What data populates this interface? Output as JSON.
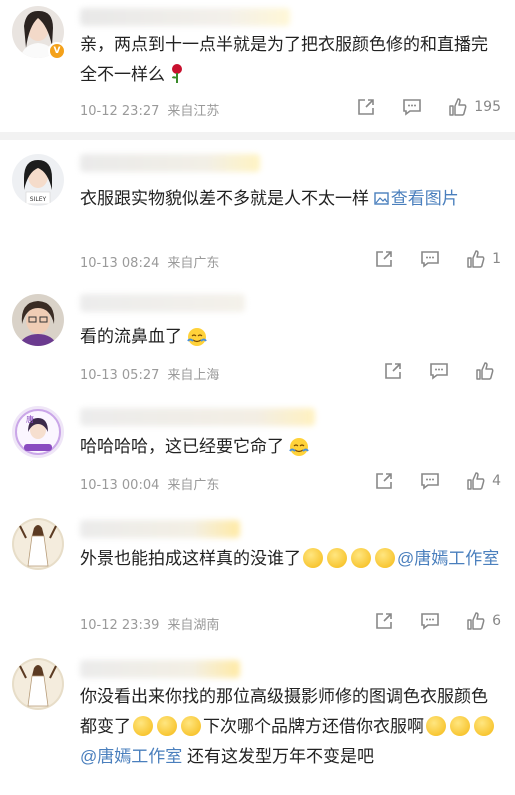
{
  "comments": [
    {
      "text": "亲，两点到十一点半就是为了把衣服颜色修的和直播完全不一样么",
      "time": "10-12 23:27",
      "source": "来自江苏",
      "likes": "195"
    },
    {
      "text": "衣服跟实物貌似差不多就是人不太一样 ",
      "link": "查看图片",
      "time": "10-13 08:24",
      "source": "来自广东",
      "likes": "1"
    },
    {
      "text": "看的流鼻血了",
      "time": "10-13 05:27",
      "source": "来自上海",
      "likes": ""
    },
    {
      "text": "哈哈哈哈，这已经要它命了",
      "time": "10-13 00:04",
      "source": "来自广东",
      "likes": "4"
    },
    {
      "text": "外景也能拍成这样真的没谁了",
      "mention": "@唐嫣工作室",
      "time": "10-12 23:39",
      "source": "来自湖南",
      "likes": "6"
    },
    {
      "text_a": "你没看出来你找的那位高级摄影师修的图调色衣服颜色都变了",
      "text_b": "下次哪个品牌方还借你衣服啊",
      "mention": "@唐嫣工作室",
      "text_c": " 还有这发型万年不变是吧"
    }
  ],
  "colors": {
    "link": "#4a7fbd",
    "meta": "#9a9a9a",
    "badge": "#f4a11a"
  },
  "icons": [
    "share-icon",
    "comment-icon",
    "like-icon",
    "rose-emoji",
    "sweat-emoji",
    "smile-emoji"
  ]
}
